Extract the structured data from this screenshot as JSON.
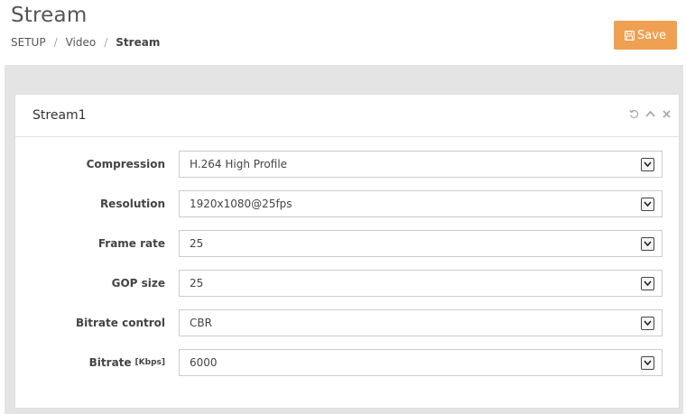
{
  "page": {
    "title": "Stream",
    "breadcrumb": [
      "SETUP",
      "Video",
      "Stream"
    ],
    "breadcrumb_separator": "/"
  },
  "toolbar": {
    "save_label": "Save",
    "save_icon": "floppy-disk-icon",
    "accent_color": "#f0a051"
  },
  "panel": {
    "title": "Stream1",
    "tools": [
      "refresh-icon",
      "collapse-icon",
      "close-icon"
    ]
  },
  "form": {
    "fields": [
      {
        "label": "Compression",
        "unit": "",
        "value": "H.264 High Profile"
      },
      {
        "label": "Resolution",
        "unit": "",
        "value": "1920x1080@25fps"
      },
      {
        "label": "Frame rate",
        "unit": "",
        "value": "25"
      },
      {
        "label": "GOP size",
        "unit": "",
        "value": "25"
      },
      {
        "label": "Bitrate control",
        "unit": "",
        "value": "CBR"
      },
      {
        "label": "Bitrate",
        "unit": "[Kbps]",
        "value": "6000"
      }
    ]
  }
}
